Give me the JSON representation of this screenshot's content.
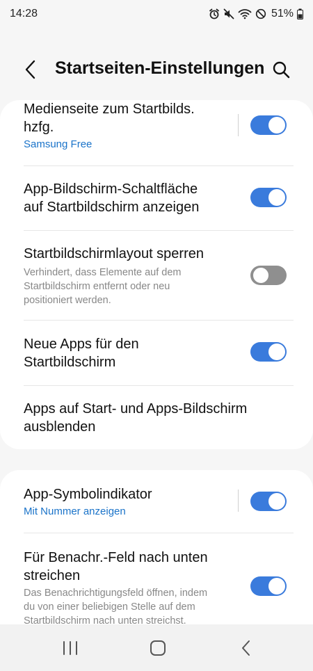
{
  "status_bar": {
    "time": "14:28",
    "battery": "51%",
    "icons": [
      "alarm-icon",
      "mute-icon",
      "wifi-icon",
      "do-not-disturb-icon",
      "battery-icon"
    ]
  },
  "header": {
    "title": "Startseiten-Einstellungen",
    "back_icon": "chevron-left-icon",
    "search_icon": "search-icon"
  },
  "colors": {
    "accent": "#3a7bdc",
    "link": "#1a73c9",
    "toggle_off": "#8f8f8f",
    "background": "#f6f6f6"
  },
  "card1": {
    "items": [
      {
        "title_line1": "Medienseite zum Startbilds.",
        "title_line2": "hzfg.",
        "subtitle": "Samsung Free",
        "toggle": true
      },
      {
        "title_line1": "App-Bildschirm-Schaltfläche",
        "title_line2": "auf Startbildschirm anzeigen",
        "toggle": true
      },
      {
        "title": "Startbildschirmlayout sperren",
        "desc_line1": "Verhindert, dass Elemente auf dem",
        "desc_line2": "Startbildschirm entfernt oder neu",
        "desc_line3": "positioniert werden.",
        "toggle": false
      },
      {
        "title_line1": "Neue Apps für den",
        "title_line2": "Startbildschirm",
        "toggle": true
      },
      {
        "title_line1": "Apps auf Start- und Apps-Bildschirm",
        "title_line2": "ausblenden"
      }
    ]
  },
  "card2": {
    "items": [
      {
        "title": "App-Symbolindikator",
        "subtitle": "Mit Nummer anzeigen",
        "toggle": true
      },
      {
        "title_line1": "Für Benachr.-Feld nach unten",
        "title_line2": "streichen",
        "desc_line1": "Das Benachrichtigungsfeld öffnen, indem",
        "desc_line2": "du von einer beliebigen Stelle auf dem",
        "desc_line3": "Startbildschirm nach unten streichst.",
        "toggle": true
      }
    ]
  },
  "nav_bar": {
    "buttons": [
      "recent-apps-icon",
      "home-icon",
      "back-icon"
    ]
  }
}
